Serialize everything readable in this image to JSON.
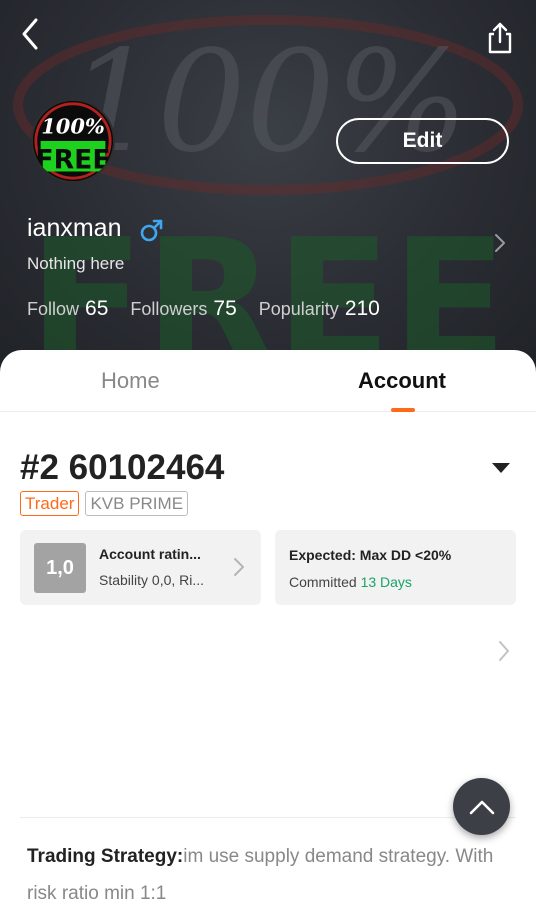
{
  "cover": {
    "watermark_percent": "100%",
    "watermark_free": "FREE"
  },
  "avatar": {
    "line1": "100%",
    "line2": "FREE"
  },
  "header": {
    "back_icon": "chevron-left-icon",
    "share_icon": "share-icon",
    "edit_label": "Edit"
  },
  "profile": {
    "username": "ianxman",
    "gender_icon": "male-icon",
    "bio": "Nothing here"
  },
  "stats": [
    {
      "label": "Follow",
      "value": "65"
    },
    {
      "label": "Followers",
      "value": "75"
    },
    {
      "label": "Popularity",
      "value": "210"
    }
  ],
  "tabs": {
    "home": "Home",
    "account": "Account",
    "active": "Account"
  },
  "account": {
    "title": "#2 60102464",
    "badges": [
      "Trader",
      "KVB PRIME"
    ],
    "rating": {
      "score": "1,0",
      "title": "Account ratin...",
      "subtitle": "Stability 0,0, Ri..."
    },
    "expectation": {
      "title": "Expected: Max DD <20%",
      "committed_label": "Committed",
      "committed_value": "13 Days"
    }
  },
  "strategy": {
    "label": "Trading Strategy:",
    "text": "im use supply demand strategy. With risk ratio min 1:1"
  },
  "colors": {
    "accent": "#ff6a1a",
    "success": "#1aa36a",
    "cover_bg": "#2a2d33"
  }
}
